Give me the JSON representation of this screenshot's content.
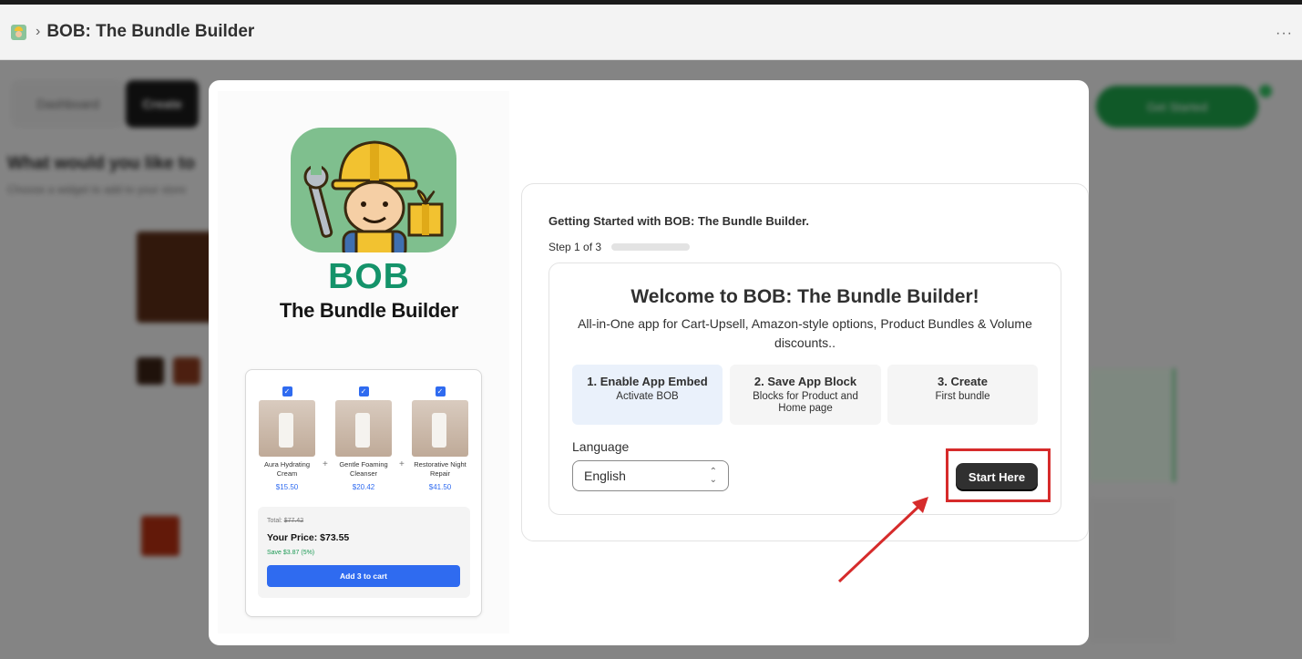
{
  "header": {
    "app_icon": "bob-mascot-icon",
    "separator": "›",
    "title": "BOB: The Bundle Builder",
    "more": "···"
  },
  "background": {
    "tab1": "Dashboard",
    "tab2": "Create",
    "heading": "What would you like to",
    "subheading": "Choose a widget to add to your store",
    "cta": "Get Started"
  },
  "modal": {
    "logo": {
      "title": "BOB",
      "subtitle": "The Bundle Builder"
    },
    "preview": {
      "products": [
        {
          "name": "Aura Hydrating Cream",
          "price": "$15.50"
        },
        {
          "name": "Gentle Foaming Cleanser",
          "price": "$20.42"
        },
        {
          "name": "Restorative Night Repair",
          "price": "$41.50"
        }
      ],
      "total_label": "Total:",
      "total_old": "$77.42",
      "your_price": "Your Price: $73.55",
      "save": "Save $3.87 (5%)",
      "add_button": "Add 3 to cart"
    },
    "getting_started": "Getting Started with BOB: The Bundle Builder.",
    "step_label": "Step 1 of 3",
    "progress_fraction": 0.0,
    "welcome": {
      "title": "Welcome to BOB: The Bundle Builder!",
      "description": "All-in-One app for Cart-Upsell, Amazon-style options, Product Bundles & Volume discounts.."
    },
    "steps": [
      {
        "title": "1. Enable App Embed",
        "subtitle": "Activate BOB"
      },
      {
        "title": "2. Save App Block",
        "subtitle": "Blocks for Product and Home page"
      },
      {
        "title": "3. Create",
        "subtitle": "First bundle"
      }
    ],
    "language_label": "Language",
    "language_value": "English",
    "start_button": "Start Here"
  },
  "colors": {
    "brand_green": "#14936a",
    "annotation_red": "#d62b2b",
    "primary_button": "#303030",
    "active_step_bg": "#eaf1fb",
    "cart_blue": "#2f6bf0"
  }
}
